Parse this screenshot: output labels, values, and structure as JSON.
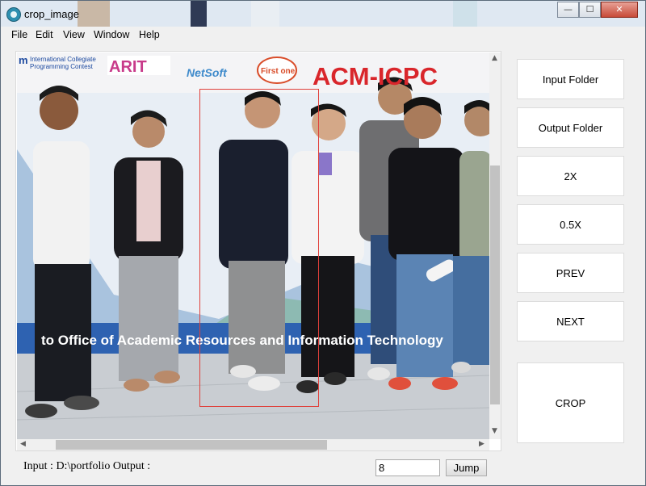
{
  "window": {
    "title": "crop_image",
    "controls": {
      "minimize": "—",
      "maximize": "☐",
      "close": "✕"
    }
  },
  "menu": [
    "File",
    "Edit",
    "View",
    "Window",
    "Help"
  ],
  "image": {
    "banner": {
      "icpc_line1": "International Collegiate",
      "icpc_line2": "Programming Contest",
      "arit": "ARIT",
      "netsoft": "NetSoft",
      "first_one": "First one",
      "acm": "ACM-ICPC",
      "bottom_text": "to Office of Academic Resources and Information Technology"
    },
    "crop_color": "#e0403a"
  },
  "sidebar": {
    "input_folder": "Input Folder",
    "output_folder": "Output Folder",
    "zoom_in": "2X",
    "zoom_out": "0.5X",
    "prev": "PREV",
    "next": "NEXT",
    "crop": "CROP"
  },
  "status": {
    "text": "Input : D:\\portfolio Output :"
  },
  "page": {
    "value": "8",
    "jump_label": "Jump"
  }
}
